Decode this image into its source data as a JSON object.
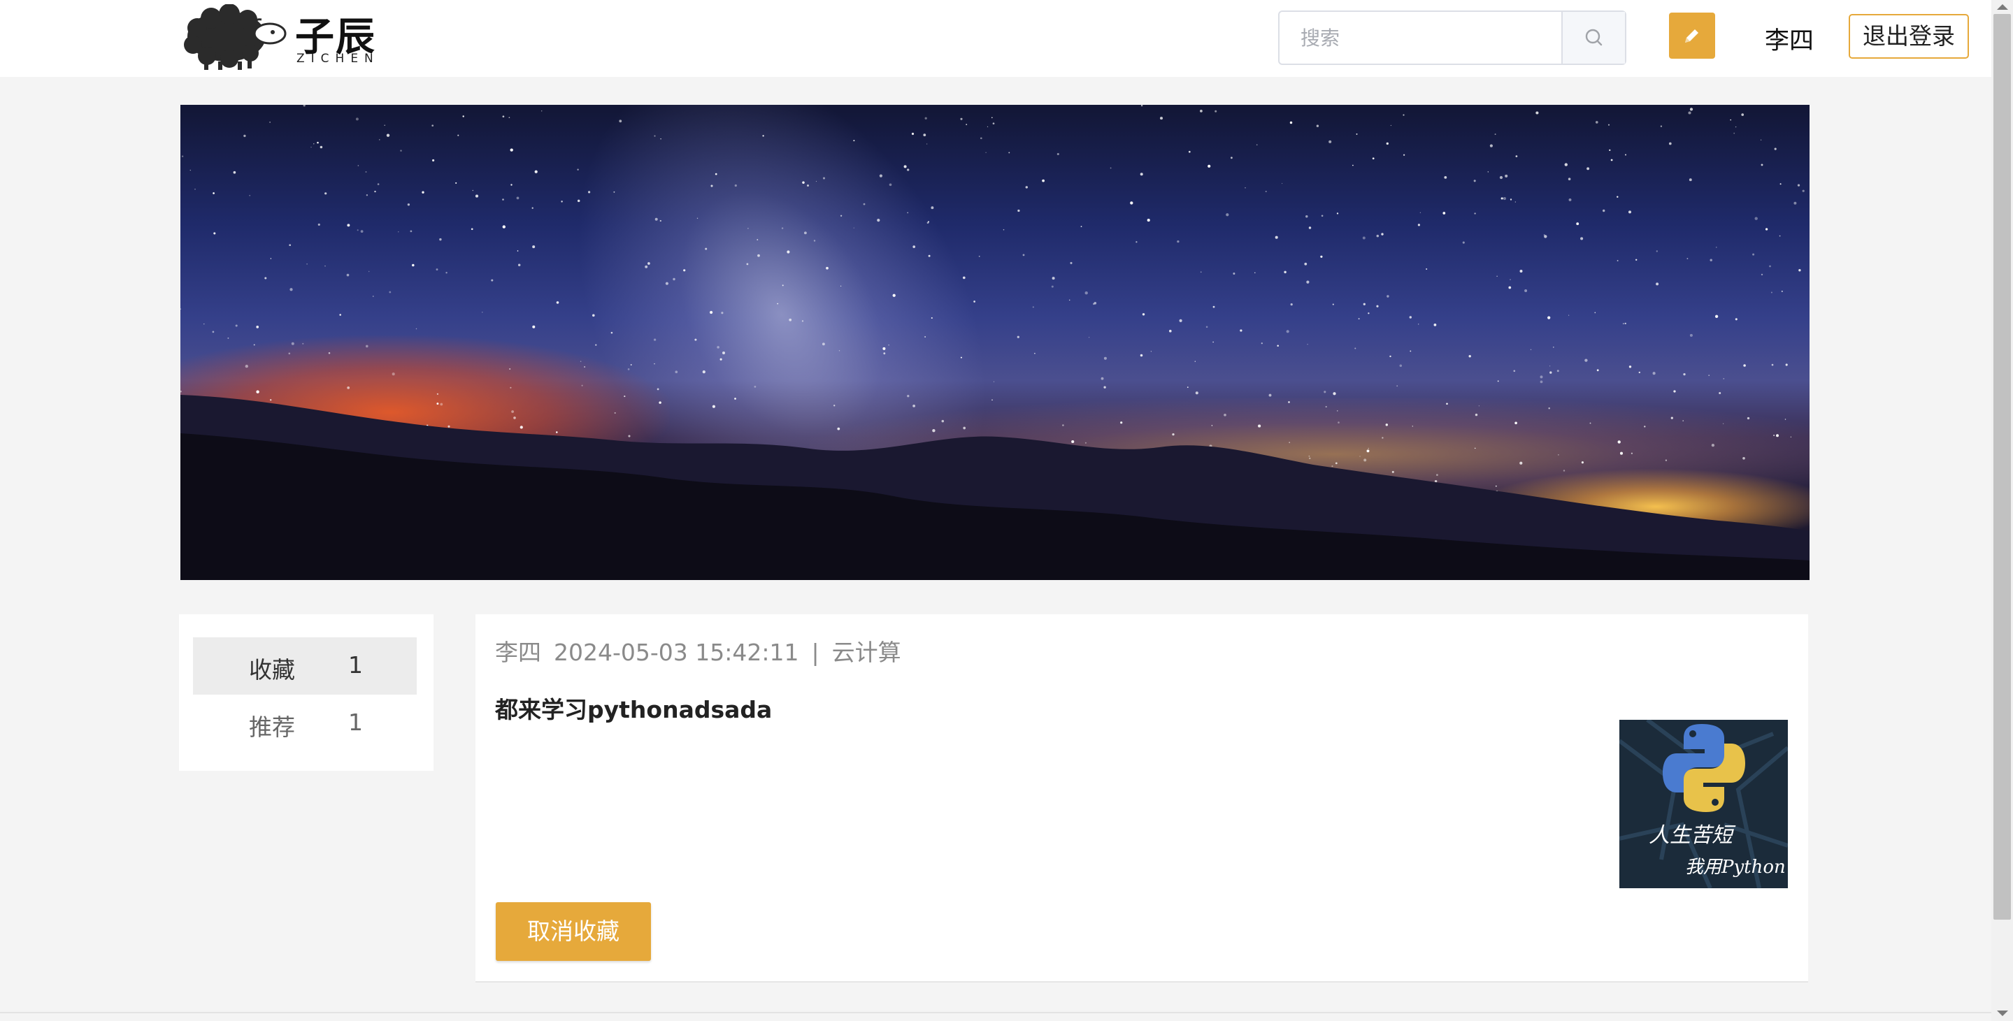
{
  "header": {
    "logo": {
      "name_cn": "子辰",
      "name_en": "ZICHEN"
    },
    "search": {
      "placeholder": "搜索",
      "value": "",
      "icon": "search-icon"
    },
    "write_icon": "pencil-icon",
    "username": "李四",
    "logout_label": "退出登录"
  },
  "banner": {
    "description_icon": "starry-night-banner"
  },
  "sidebar": {
    "items": [
      {
        "label": "收藏",
        "count": "1",
        "active": true
      },
      {
        "label": "推荐",
        "count": "1",
        "active": false
      }
    ]
  },
  "post": {
    "author": "李四",
    "datetime": "2024-05-03 15:42:11",
    "separator": "|",
    "category": "云计算",
    "title": "都来学习pythonadsada",
    "thumbnail": {
      "line1": "人生苦短",
      "line2": "我用Python"
    },
    "unfavorite_label": "取消收藏"
  },
  "colors": {
    "accent": "#e6a93b",
    "background": "#f4f4f4",
    "card": "#ffffff",
    "meta_text": "#8a8a8a"
  }
}
